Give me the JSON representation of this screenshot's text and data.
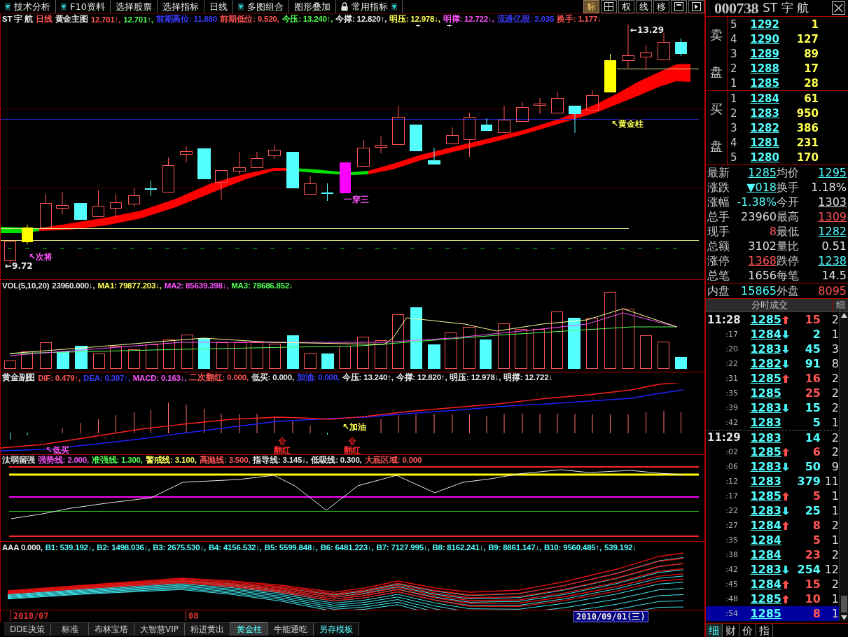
{
  "toolbar": {
    "items": [
      {
        "label": "技术分析",
        "arrow_before": true,
        "arrow_after": false,
        "locked": false
      },
      {
        "label": "F10资料",
        "arrow_before": true,
        "arrow_after": false,
        "locked": false
      },
      {
        "label": "选择股票",
        "arrow_before": false,
        "arrow_after": false,
        "locked": false
      },
      {
        "label": "选择指标",
        "arrow_before": false,
        "arrow_after": false,
        "locked": false
      },
      {
        "label": "日线",
        "arrow_before": false,
        "arrow_after": false,
        "locked": false
      },
      {
        "label": "多图组合",
        "arrow_before": true,
        "arrow_after": false,
        "locked": false
      },
      {
        "label": "图形叠加",
        "arrow_before": false,
        "arrow_after": false,
        "locked": false
      },
      {
        "label": "常用指标",
        "arrow_before": false,
        "arrow_after": true,
        "locked": true
      }
    ],
    "view_buttons": [
      {
        "kind": "text",
        "label": "标",
        "selected": true
      },
      {
        "kind": "grid",
        "selected": false
      },
      {
        "kind": "text",
        "label": "权",
        "selected": false
      },
      {
        "kind": "text",
        "label": "线",
        "selected": false
      },
      {
        "kind": "text",
        "label": "移",
        "selected": false
      },
      {
        "kind": "window",
        "selected": false
      },
      {
        "kind": "next",
        "selected": false
      }
    ]
  },
  "main_chart": {
    "legend": [
      {
        "text": "ST 宇 航",
        "color": "#e8e8e8"
      },
      {
        "text": "日线",
        "color": "#ff5454"
      },
      {
        "text": "黄金主图",
        "color": "#e8e8e8"
      },
      {
        "text": "12.701↑,",
        "color": "#ff5454"
      },
      {
        "text": "12.701↑,",
        "color": "#54ff54"
      },
      {
        "text": "前期高位: 11.880",
        "color": "#3c3cff"
      },
      {
        "text": "前期低位: 9.520,",
        "color": "#ff5454"
      },
      {
        "text": "今压: 13.240↑,",
        "color": "#54ff54"
      },
      {
        "text": "今撑: 12.820↑,",
        "color": "#e8e8e8"
      },
      {
        "text": "明压: 12.978↓,",
        "color": "#ffff54"
      },
      {
        "text": "明撑: 12.722↓,",
        "color": "#ff54ff"
      },
      {
        "text": "流通亿股: 2.035",
        "color": "#3c3cff"
      },
      {
        "text": "换手: 1.177↓",
        "color": "#ff5454"
      }
    ],
    "annotations": [
      {
        "text": "←13.29",
        "color": "#e8e8e8"
      },
      {
        "text": "↖黄金柱",
        "color": "#ffff54"
      },
      {
        "text": "↖次将",
        "color": "#ff54ff"
      },
      {
        "text": "一穿三",
        "color": "#ff54ff"
      },
      {
        "text": "←9.72",
        "color": "#e8e8e8"
      }
    ]
  },
  "volume_panel": {
    "legend": [
      {
        "text": "VOL(5,10,20)",
        "color": "#e8e8e8"
      },
      {
        "text": "23960.000↓,",
        "color": "#e8e8e8"
      },
      {
        "text": "MA1: 79877.203↓,",
        "color": "#ffff54"
      },
      {
        "text": "MA2: 85639.398↓,",
        "color": "#ff54ff"
      },
      {
        "text": "MA3: 78686.852↓",
        "color": "#54ff54"
      }
    ]
  },
  "macd_panel": {
    "legend": [
      {
        "text": "黄金副图",
        "color": "#e8e8e8"
      },
      {
        "text": "DIF: 0.479↑,",
        "color": "#ff5454"
      },
      {
        "text": "DEA: 0.397↑,",
        "color": "#3c3cff"
      },
      {
        "text": "MACD: 0.163↓,",
        "color": "#ff54ff"
      },
      {
        "text": "二次翻红: 0.000,",
        "color": "#ff5454"
      },
      {
        "text": "低买: 0.000,",
        "color": "#e8e8e8"
      },
      {
        "text": "加油: 0.000,",
        "color": "#3c3cff"
      },
      {
        "text": "今压: 13.240↑,",
        "color": "#e8e8e8"
      },
      {
        "text": "今撑: 12.820↑,",
        "color": "#e8e8e8"
      },
      {
        "text": "明压: 12.978↓,",
        "color": "#e8e8e8"
      },
      {
        "text": "明撑: 12.722↓",
        "color": "#e8e8e8"
      }
    ],
    "annotations": [
      {
        "text": "↖加油",
        "color": "#ffff54",
        "kind": "label"
      },
      {
        "text": "↖低买",
        "color": "#ff54ff",
        "kind": "label"
      },
      {
        "text": "翻红",
        "color": "#ff3030",
        "kind": "signal"
      },
      {
        "text": "翻红",
        "color": "#ff3030",
        "kind": "signal"
      }
    ]
  },
  "strength_panel": {
    "legend": [
      {
        "text": "汰弱留强",
        "color": "#e8e8e8"
      },
      {
        "text": "强势线: 2.000,",
        "color": "#ff54ff"
      },
      {
        "text": "准强线: 1.300,",
        "color": "#54ff54"
      },
      {
        "text": "警戒线: 3.100,",
        "color": "#ffff54"
      },
      {
        "text": "高抛线: 3.500,",
        "color": "#ff5454"
      },
      {
        "text": "指导线: 3.145↓,",
        "color": "#e8e8e8"
      },
      {
        "text": "低吸线: 0.300,",
        "color": "#e8e8e8"
      },
      {
        "text": "大底区域: 0.000",
        "color": "#ff5454"
      }
    ]
  },
  "aaa_panel": {
    "legend": [
      {
        "text": "AAA 0.000,",
        "color": "#e8e8e8"
      },
      {
        "text": "B1: 539.192↓,",
        "color": "#54ffff"
      },
      {
        "text": "B2: 1498.036↓,",
        "color": "#54ffff"
      },
      {
        "text": "B3: 2675.530↓,",
        "color": "#54ffff"
      },
      {
        "text": "B4: 4156.532↓,",
        "color": "#54ffff"
      },
      {
        "text": "B5: 5599.848↓,",
        "color": "#54ffff"
      },
      {
        "text": "B6: 6481.223↓,",
        "color": "#54ffff"
      },
      {
        "text": "B7: 7127.995↓,",
        "color": "#54ffff"
      },
      {
        "text": "B8: 8162.241↓,",
        "color": "#54ffff"
      },
      {
        "text": "B9: 8861.147↓,",
        "color": "#54ffff"
      },
      {
        "text": "B10: 9560.485↑,",
        "color": "#54ffff"
      },
      {
        "text": "539.192↓",
        "color": "#54ffff"
      }
    ]
  },
  "date_axis": {
    "labels": [
      {
        "text": "2010/07",
        "selected": false
      },
      {
        "text": "08",
        "selected": false
      },
      {
        "text": "2010/09/01(三)",
        "selected": true
      }
    ]
  },
  "bottom_tabs": [
    {
      "label": "DDE决策",
      "kind": "tab",
      "selected": false
    },
    {
      "label": "标准",
      "kind": "tab",
      "selected": false
    },
    {
      "label": "布林宝塔",
      "kind": "tab",
      "selected": false
    },
    {
      "label": "大智慧VIP",
      "kind": "tab",
      "selected": false
    },
    {
      "label": "粉进黄出",
      "kind": "tab",
      "selected": false
    },
    {
      "label": "黄金柱",
      "kind": "tab",
      "selected": true
    },
    {
      "label": "牛能通吃",
      "kind": "tab",
      "selected": false
    },
    {
      "label": "另存模板",
      "kind": "action",
      "selected": false
    }
  ],
  "quote": {
    "code": "000738",
    "name": "ST 宇 航",
    "sell_label": [
      "卖",
      "盘"
    ],
    "buy_label": [
      "买",
      "盘"
    ],
    "asks": [
      {
        "rank": "5",
        "price": "1292",
        "volume": "1"
      },
      {
        "rank": "4",
        "price": "1290",
        "volume": "127"
      },
      {
        "rank": "3",
        "price": "1289",
        "volume": "89"
      },
      {
        "rank": "2",
        "price": "1288",
        "volume": "17"
      },
      {
        "rank": "1",
        "price": "1285",
        "volume": "28"
      }
    ],
    "bids": [
      {
        "rank": "1",
        "price": "1284",
        "volume": "61"
      },
      {
        "rank": "2",
        "price": "1283",
        "volume": "950"
      },
      {
        "rank": "3",
        "price": "1282",
        "volume": "386"
      },
      {
        "rank": "4",
        "price": "1281",
        "volume": "231"
      },
      {
        "rank": "5",
        "price": "1280",
        "volume": "170"
      }
    ],
    "stats": [
      {
        "label": "最新",
        "value": "1285",
        "color": "#54ffff",
        "underlined": true
      },
      {
        "label": "均价",
        "value": "1295",
        "color": "#54ffff",
        "underlined": true
      },
      {
        "label": "涨跌",
        "value": "▼018",
        "color": "#54ffff",
        "underlined": true
      },
      {
        "label": "换手",
        "value": "1.18%",
        "color": "#e0e0e0",
        "underlined": false
      },
      {
        "label": "涨幅",
        "value": "-1.38%",
        "color": "#54ffff",
        "underlined": false
      },
      {
        "label": "今开",
        "value": "1303",
        "color": "#e0e0e0",
        "underlined": true
      },
      {
        "label": "总手",
        "value": "23960",
        "color": "#e0e0e0",
        "underlined": false
      },
      {
        "label": "最高",
        "value": "1309",
        "color": "#ff5454",
        "underlined": true
      },
      {
        "label": "现手",
        "value": "8",
        "color": "#ff5454",
        "underlined": false
      },
      {
        "label": "最低",
        "value": "1282",
        "color": "#54ffff",
        "underlined": true
      },
      {
        "label": "总额",
        "value": "3102",
        "color": "#e0e0e0",
        "underlined": false
      },
      {
        "label": "量比",
        "value": "0.51",
        "color": "#e0e0e0",
        "underlined": false
      },
      {
        "label": "涨停",
        "value": "1368",
        "color": "#ff5454",
        "underlined": true
      },
      {
        "label": "跌停",
        "value": "1238",
        "color": "#54ffff",
        "underlined": true
      },
      {
        "label": "总笔",
        "value": "1656",
        "color": "#e0e0e0",
        "underlined": false
      },
      {
        "label": "每笔",
        "value": "14.5",
        "color": "#e0e0e0",
        "underlined": false
      }
    ],
    "flow": [
      {
        "label": "内盘",
        "value": "15865",
        "color": "#54ffff"
      },
      {
        "label": "外盘",
        "value": "8095",
        "color": "#ff5454"
      }
    ]
  },
  "trades": {
    "title": "分时成交",
    "detail_button": "细",
    "rows": [
      {
        "time": "11:28",
        "kind": "minute",
        "price": "1285",
        "up": true,
        "down": false,
        "volume": "15",
        "color": "#ff5454",
        "count": "2",
        "selected": false
      },
      {
        "time": ":17",
        "kind": "second",
        "price": "1284",
        "up": false,
        "down": true,
        "volume": "2",
        "color": "#54ffff",
        "count": "1",
        "selected": false
      },
      {
        "time": ":20",
        "kind": "second",
        "price": "1283",
        "up": false,
        "down": true,
        "volume": "45",
        "color": "#54ffff",
        "count": "3",
        "selected": false
      },
      {
        "time": ":22",
        "kind": "second",
        "price": "1282",
        "up": false,
        "down": true,
        "volume": "91",
        "color": "#54ffff",
        "count": "8",
        "selected": false
      },
      {
        "time": ":31",
        "kind": "second",
        "price": "1285",
        "up": true,
        "down": false,
        "volume": "16",
        "color": "#ff5454",
        "count": "2",
        "selected": false
      },
      {
        "time": ":35",
        "kind": "second",
        "price": "1285",
        "up": false,
        "down": false,
        "volume": "25",
        "color": "#ff5454",
        "count": "2",
        "selected": false
      },
      {
        "time": ":39",
        "kind": "second",
        "price": "1283",
        "up": false,
        "down": true,
        "volume": "15",
        "color": "#54ffff",
        "count": "2",
        "selected": false
      },
      {
        "time": ":42",
        "kind": "second",
        "price": "1283",
        "up": false,
        "down": false,
        "volume": "5",
        "color": "#54ffff",
        "count": "1",
        "selected": false
      },
      {
        "time": "11:29",
        "kind": "minute",
        "price": "1283",
        "up": false,
        "down": false,
        "volume": "14",
        "color": "#54ffff",
        "count": "2",
        "selected": false
      },
      {
        "time": ":02",
        "kind": "second",
        "price": "1285",
        "up": true,
        "down": false,
        "volume": "6",
        "color": "#ff5454",
        "count": "2",
        "selected": false
      },
      {
        "time": ":06",
        "kind": "second",
        "price": "1283",
        "up": false,
        "down": true,
        "volume": "50",
        "color": "#54ffff",
        "count": "9",
        "selected": false
      },
      {
        "time": ":12",
        "kind": "second",
        "price": "1283",
        "up": false,
        "down": false,
        "volume": "379",
        "color": "#54ffff",
        "count": "11",
        "selected": false
      },
      {
        "time": ":17",
        "kind": "second",
        "price": "1285",
        "up": true,
        "down": false,
        "volume": "5",
        "color": "#ff5454",
        "count": "1",
        "selected": false
      },
      {
        "time": ":22",
        "kind": "second",
        "price": "1283",
        "up": false,
        "down": true,
        "volume": "25",
        "color": "#54ffff",
        "count": "1",
        "selected": false
      },
      {
        "time": ":27",
        "kind": "second",
        "price": "1284",
        "up": true,
        "down": false,
        "volume": "8",
        "color": "#ff5454",
        "count": "2",
        "selected": false
      },
      {
        "time": ":35",
        "kind": "second",
        "price": "1284",
        "up": false,
        "down": false,
        "volume": "5",
        "color": "#ff5454",
        "count": "1",
        "selected": false
      },
      {
        "time": ":38",
        "kind": "second",
        "price": "1284",
        "up": false,
        "down": false,
        "volume": "23",
        "color": "#ff5454",
        "count": "2",
        "selected": false
      },
      {
        "time": ":42",
        "kind": "second",
        "price": "1283",
        "up": false,
        "down": true,
        "volume": "254",
        "color": "#54ffff",
        "count": "12",
        "selected": false
      },
      {
        "time": ":45",
        "kind": "second",
        "price": "1284",
        "up": true,
        "down": false,
        "volume": "15",
        "color": "#ff5454",
        "count": "2",
        "selected": false
      },
      {
        "time": ":48",
        "kind": "second",
        "price": "1285",
        "up": true,
        "down": false,
        "volume": "10",
        "color": "#ff5454",
        "count": "1",
        "selected": false
      },
      {
        "time": ":54",
        "kind": "second",
        "price": "1285",
        "up": false,
        "down": false,
        "volume": "8",
        "color": "#ff5454",
        "count": "1",
        "selected": true
      }
    ]
  },
  "side_tabs": [
    {
      "label": "细",
      "selected": true
    },
    {
      "label": "财",
      "selected": false
    },
    {
      "label": "价",
      "selected": false
    },
    {
      "label": "指",
      "selected": false
    }
  ]
}
